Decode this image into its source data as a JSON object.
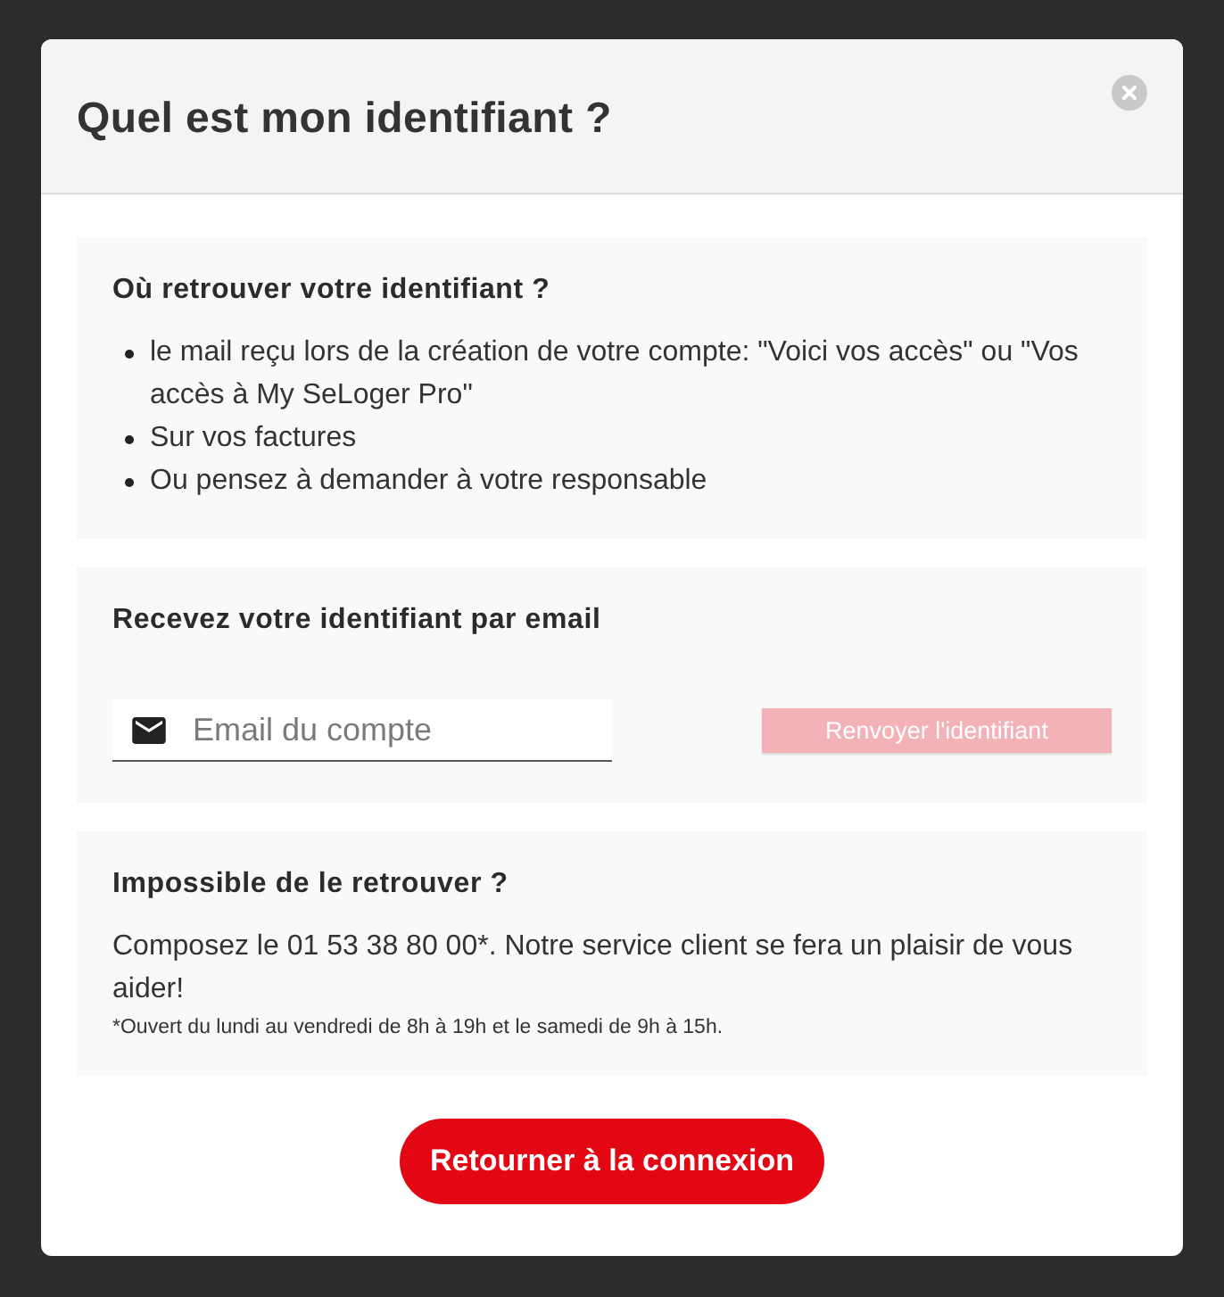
{
  "dialog": {
    "title": "Quel est mon identifiant ?"
  },
  "where_section": {
    "heading": "Où retrouver votre identifiant ?",
    "items": [
      "le mail reçu lors de la création de votre compte: \"Voici vos accès\" ou \"Vos accès à My SeLoger Pro\"",
      "Sur vos factures",
      "Ou pensez à demander à votre responsable"
    ]
  },
  "email_section": {
    "heading": "Recevez votre identifiant par email",
    "email_field": {
      "placeholder": "Email du compte"
    },
    "resend_button": {
      "label": "Renvoyer l'identifiant",
      "disabled": true
    }
  },
  "help_section": {
    "heading": "Impossible de le retrouver ?",
    "text": "Composez le 01 53 38 80 00*. Notre service client se fera un plaisir de vous aider!",
    "footnote": "*Ouvert du lundi au vendredi de 8h à 19h et le samedi de 9h à 15h."
  },
  "back_button": {
    "label": "Retourner à la connexion"
  }
}
